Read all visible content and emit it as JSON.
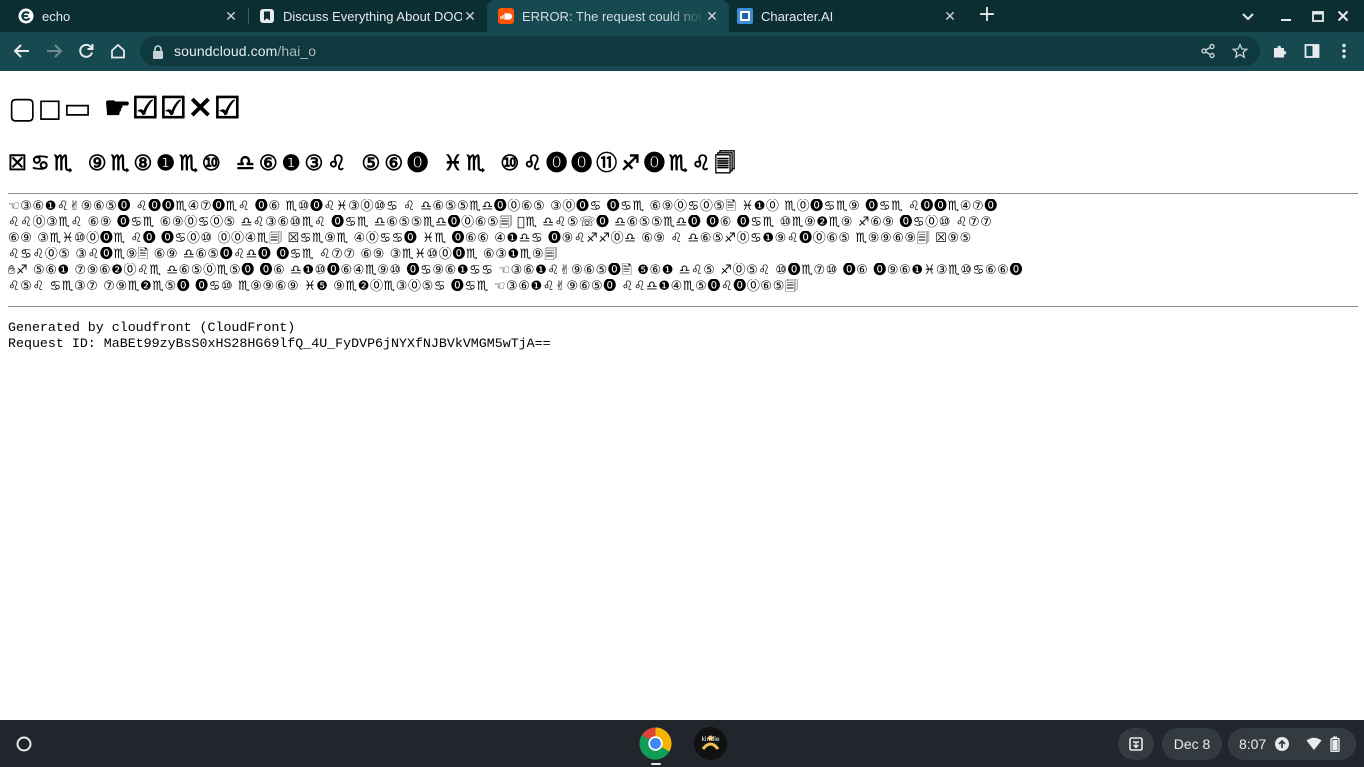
{
  "tabs": [
    {
      "title": "echo",
      "icon": "echo-logo-icon",
      "active": false
    },
    {
      "title": "Discuss Everything About DOORS",
      "icon": "bookmark-site-icon",
      "active": false
    },
    {
      "title": "ERROR: The request could not be satisfied",
      "icon": "soundcloud-icon",
      "active": true
    },
    {
      "title": "Character.AI",
      "icon": "character-ai-icon",
      "active": false
    }
  ],
  "address_bar": {
    "host": "soundcloud.com",
    "path": "/hai_o"
  },
  "page": {
    "heading1": "▢◻︎▭  ☛☑︎☑︎✕☑︎",
    "heading2": "☒♋︎♏︎ ⑨♏︎⑧❶♏︎⑩ ♎︎⑥❶③♌︎ ⑤⑥⓿ ♓︎♏︎ ⑩♌︎⓿⓿⑪♐︎⓿♏︎♌︎🗐",
    "body_lines": [
      "☜③⑥❶♌︎✌︎⑨⑥⑤⓿ ♌︎⓿⓿♏︎④⑦⓿♏︎♌︎ ⓿⑥ ♏︎⑩⓿♌︎♓︎③⓪⑩♋︎ ♌︎ ♎︎⑥⑤⑤♏︎♎︎⓿⓪⑥⑤ ③⓪⓿♋︎ ⓿♋︎♏︎ ⑥⑨⓪♋︎⓪⑤🖹 ♓︎❶⓪ ♏︎⓪⓿♋︎♏︎⑨ ⓿♋︎♏︎ ♌︎⓿⓿♏︎④⑦⓿",
      "♌︎♌︎⓪③♏︎♌︎ ⑥⑨ ⓿♋︎♏︎ ⑥⑨⓪♋︎⓪⑤ ♎︎♌︎③⑥⑩♏︎♌︎ ⓿♋︎♏︎ ♎︎⑥⑤⑤♏︎♎︎⓿⓪⑥⑤🗐 ⃠♏︎ ♎︎♌︎⑤☏⓿ ♎︎⑥⑤⑤♏︎♎︎⓿ ⓿⑥ ⓿♋︎♏︎ ⑩♏︎⑨❷♏︎⑨ ♐︎⑥⑨ ⓿♋︎⓪⑩ ♌︎⑦⑦",
      "⑥⑨ ③♏︎♓︎⑩⓪⓿♏︎ ♌︎⓿ ⓿♋︎⓪⑩ ⓪⓪④♏︎🗐 ☒♋︎♏︎⑨♏︎ ④⓪♋︎♋︎⓿ ♓︎♏︎ ⓿⑥⑥ ④❶♎︎♋︎ ⓿⑨♌︎♐︎♐︎⓪♎︎ ⑥⑨ ♌︎ ♎︎⑥⑤♐︎⓪♋︎❶⑨♌︎⓿⓪⑥⑤ ♏︎⑨⑨⑥⑨🗐 ☒⑨⑤",
      "♌︎♋︎♌︎⓪⑤ ③♌︎⓿♏︎⑨🖹 ⑥⑨ ♎︎⑥⑤⓿♌︎♎︎⓿ ⓿♋︎♏︎ ♌︎⑦⑦ ⑥⑨ ③♏︎♓︎⑩⓪⓿♏︎ ⑥③❶♏︎⑨🗐",
      "✋︎♐︎ ⑤⑥❶ ⑦⑨⑥❷⓪♌︎♏︎ ♎︎⑥⑤⓪♏︎⑤⓿ ⓿⑥ ♎︎❶⑩⓿⑥④♏︎⑨⑩ ⓿♋︎⑨⑥❶♋︎♋︎ ☜③⑥❶♌︎✌︎⑨⑥⑤⓿🖹 ❺⑥❶ ♎︎♌︎⑤ ♐︎⓪⑤♌︎ ⑩⓿♏︎⑦⑩ ⓿⑥ ⓿⑨⑥❶♓︎③♏︎⑩♋︎⑥⑥⓿",
      "♌︎⑤♌︎ ♋︎♏︎③⑦ ⑦⑨♏︎❷♏︎⑤⓿ ⓿♋︎⑩ ♏︎⑨⑨⑥⑨ ♓︎❺ ⑨♏︎❷⓪♏︎③⓪⑤♋︎ ⓿♋︎♏︎ ☜③⑥❶♌︎✌︎⑨⑥⑤⓿ ♌︎♌︎♎︎❶④♏︎⑤⓿♌︎⓿⓪⑥⑤🗐"
    ],
    "generated_by": "Generated by cloudfront (CloudFront)",
    "request_id": "Request ID: MaBEt99zyBsS0xHS28HG69lfQ_4U_FyDVP6jNYXfNJBVkVMGM5wTjA=="
  },
  "shelf": {
    "apps": [
      {
        "name": "Chrome",
        "icon": "chrome-icon"
      },
      {
        "name": "Kindle",
        "icon": "kindle-icon"
      }
    ],
    "date": "Dec 8",
    "time": "8:07"
  },
  "colors": {
    "tabbar_bg": "#0b2e33",
    "toolbar_bg": "#164a50",
    "shelf_bg": "#20262b",
    "soundcloud_orange": "#ff5500"
  }
}
